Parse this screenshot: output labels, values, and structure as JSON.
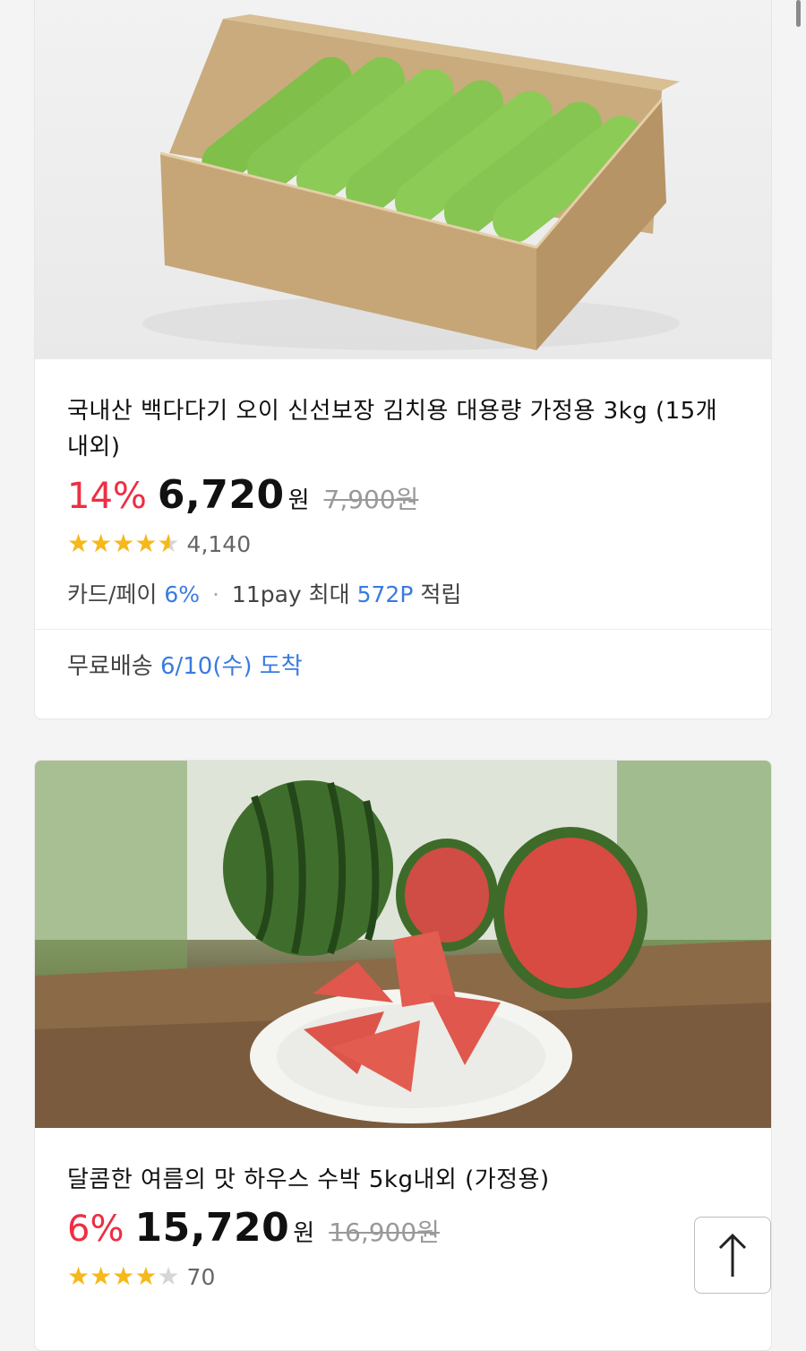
{
  "products": [
    {
      "title": "국내산 백다다기 오이 신선보장 김치용 대용량 가정용 3kg (15개 내외)",
      "discount": "14%",
      "price": "6,720",
      "currency": "원",
      "original_price": "7,900원",
      "rating": 4.5,
      "review_count": "4,140",
      "benefit": {
        "prefix": "카드/페이",
        "card_rate": "6%",
        "pay_label": "11pay 최대",
        "points": "572P",
        "suffix": "적립"
      },
      "shipping": {
        "label": "무료배송",
        "date": "6/10(수) 도착"
      }
    },
    {
      "title": "달콤한 여름의 맛 하우스 수박 5kg내외 (가정용)",
      "discount": "6%",
      "price": "15,720",
      "currency": "원",
      "original_price": "16,900원",
      "rating": 4,
      "review_count": "70"
    }
  ],
  "colors": {
    "discount": "#ee2e43",
    "accent_blue": "#3a7be0",
    "star": "#f6b81a"
  },
  "icons": {
    "scroll_top": "arrow-up-icon"
  }
}
